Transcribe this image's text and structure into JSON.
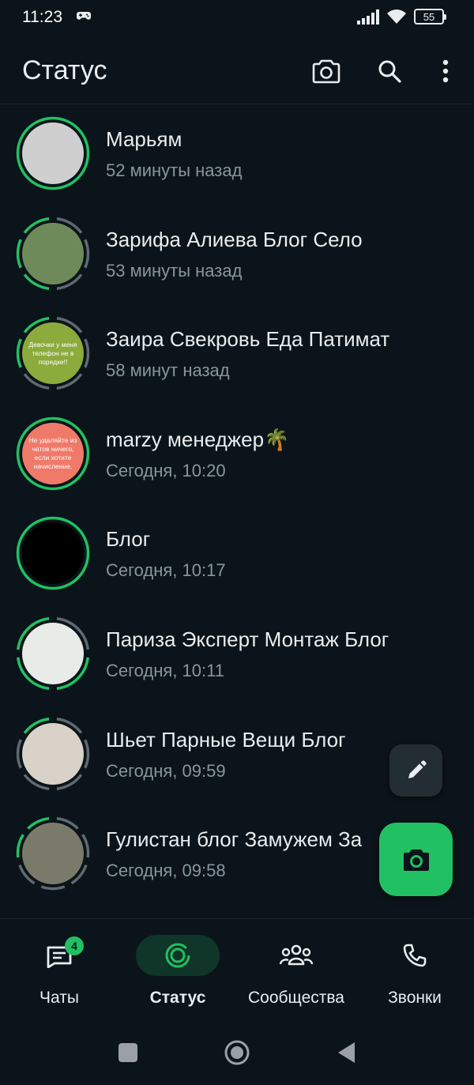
{
  "status_bar": {
    "time": "11:23",
    "battery": "55"
  },
  "header": {
    "title": "Статус"
  },
  "statuses": [
    {
      "name": "Марьям",
      "time": "52 минуты назад",
      "avatar_text": "",
      "avatar_color": "#cfcfcf",
      "segments": 1,
      "viewed": 0
    },
    {
      "name": "Зарифа Алиева Блог Село",
      "time": "53 минуты назад",
      "avatar_text": "",
      "avatar_color": "#6f8a5a",
      "segments": 6,
      "viewed": 3
    },
    {
      "name": "Заира Свекровь Еда Патимат",
      "time": "58 минут назад",
      "avatar_text": "Девочки у меня телефон не в порядке!!",
      "avatar_color": "#8bab3c",
      "segments": 6,
      "viewed": 4
    },
    {
      "name": "marzy менеджер🌴",
      "time": "Сегодня, 10:20",
      "avatar_text": "Не удаляйте из чатов ничего, если хотите начисление.",
      "avatar_color": "#f07a6a",
      "segments": 1,
      "viewed": 0
    },
    {
      "name": "Блог",
      "time": "Сегодня, 10:17",
      "avatar_text": "",
      "avatar_color": "#000000",
      "segments": 1,
      "viewed": 0
    },
    {
      "name": "Париза Эксперт Монтаж Блог",
      "time": "Сегодня, 10:11",
      "avatar_text": "",
      "avatar_color": "#e8ece6",
      "segments": 4,
      "viewed": 1
    },
    {
      "name": "Шьет Парные Вещи Блог",
      "time": "Сегодня, 09:59",
      "avatar_text": "",
      "avatar_color": "#d9d2c8",
      "segments": 6,
      "viewed": 5
    },
    {
      "name": "Гулистан блог Замужем За",
      "time": "Сегодня, 09:58",
      "avatar_text": "",
      "avatar_color": "#7a7a6a",
      "segments": 7,
      "viewed": 5
    }
  ],
  "nav": [
    {
      "label": "Чаты",
      "icon": "chats-icon",
      "badge": "4",
      "active": false
    },
    {
      "label": "Статус",
      "icon": "status-icon",
      "badge": "",
      "active": true
    },
    {
      "label": "Сообщества",
      "icon": "communities-icon",
      "badge": "",
      "active": false
    },
    {
      "label": "Звонки",
      "icon": "calls-icon",
      "badge": "",
      "active": false
    }
  ],
  "colors": {
    "accent": "#21c063",
    "background": "#0b141a",
    "viewed_ring": "#5f6a70",
    "secondary_text": "#8696a0"
  }
}
